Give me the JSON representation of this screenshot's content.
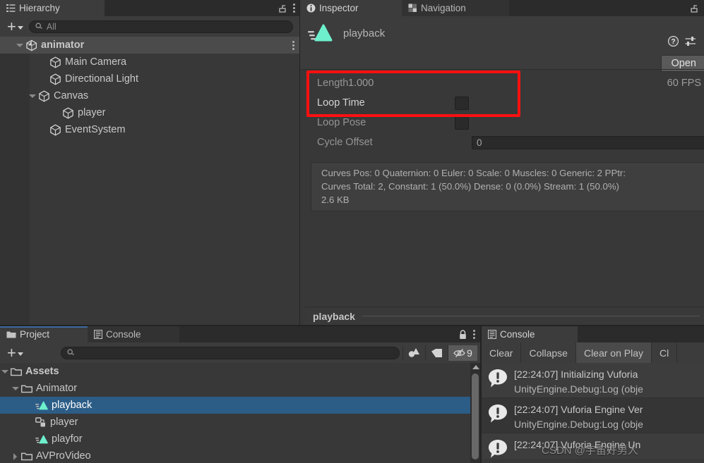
{
  "hierarchy": {
    "tab_label": "Hierarchy",
    "tab_icon": "hierarchy-icon",
    "add_label": "+",
    "search": {
      "placeholder": "All",
      "value": "",
      "icon": "search-icon"
    },
    "items": [
      {
        "label": "animator",
        "icon": "unity-scene-icon",
        "indent": 34,
        "expanded": true,
        "selected": true,
        "bold": true,
        "kebab": true
      },
      {
        "label": "Main Camera",
        "icon": "gameobject-icon",
        "indent": 68,
        "expanded": null,
        "selected": false,
        "bold": false,
        "kebab": false
      },
      {
        "label": "Directional Light",
        "icon": "gameobject-icon",
        "indent": 68,
        "expanded": null,
        "selected": false,
        "bold": false,
        "kebab": false
      },
      {
        "label": "Canvas",
        "icon": "gameobject-icon",
        "indent": 52,
        "expanded": true,
        "selected": false,
        "bold": false,
        "kebab": false
      },
      {
        "label": "player",
        "icon": "gameobject-icon",
        "indent": 86,
        "expanded": null,
        "selected": false,
        "bold": false,
        "kebab": false
      },
      {
        "label": "EventSystem",
        "icon": "gameobject-icon",
        "indent": 68,
        "expanded": null,
        "selected": false,
        "bold": false,
        "kebab": false
      }
    ]
  },
  "inspector": {
    "tabs": [
      {
        "label": "Inspector",
        "icon": "info-icon",
        "active": true
      },
      {
        "label": "Navigation",
        "icon": "navigation-icon",
        "active": false
      }
    ],
    "asset_name": "playback",
    "asset_icon": "animation-clip-icon",
    "help_icon": "help-icon",
    "preset_icon": "preset-icon",
    "open_button": "Open",
    "fps_label": "60 FPS",
    "length_label": "Length",
    "length_value": "1.000",
    "loop_time_label": "Loop Time",
    "loop_time_checked": false,
    "loop_pose_label": "Loop Pose",
    "loop_pose_checked": false,
    "cycle_offset_label": "Cycle Offset",
    "cycle_offset_value": "0",
    "curves_line1": "Curves Pos: 0 Quaternion: 0 Euler: 0 Scale: 0 Muscles: 0 Generic: 2 PPtr:",
    "curves_line2": "Curves Total: 2, Constant: 1 (50.0%) Dense: 0 (0.0%) Stream: 1 (50.0%)",
    "curves_line3": "2.6 KB",
    "preview_label": "playback",
    "highlight_color": "#ff1010"
  },
  "project": {
    "tabs": [
      {
        "label": "Project",
        "icon": "folder-icon",
        "active": true
      },
      {
        "label": "Console",
        "icon": "console-icon",
        "active": false
      }
    ],
    "accent_color": "#3d6a9e",
    "lock_icon": "lock-icon",
    "menu_icon": "kebab-menu-icon",
    "add_label": "+",
    "search": {
      "placeholder": "",
      "value": "",
      "icon": "search-icon"
    },
    "filter_type_icon": "filter-by-type-icon",
    "filter_label_icon": "filter-by-label-icon",
    "hidden_packages_icon": "hidden-packages-icon",
    "hidden_packages_count": "9",
    "items": [
      {
        "label": "Assets",
        "icon": "folder-icon",
        "indent": 10,
        "expanded": true,
        "selected": false,
        "bold": true
      },
      {
        "label": "Animator",
        "icon": "folder-icon",
        "indent": 28,
        "expanded": true,
        "selected": false,
        "bold": false
      },
      {
        "label": "playback",
        "icon": "animation-clip-icon",
        "indent": 48,
        "expanded": null,
        "selected": true,
        "bold": false
      },
      {
        "label": "player",
        "icon": "animator-controller-icon",
        "indent": 48,
        "expanded": null,
        "selected": false,
        "bold": false
      },
      {
        "label": "playfor",
        "icon": "animation-clip-icon",
        "indent": 48,
        "expanded": null,
        "selected": false,
        "bold": false
      },
      {
        "label": "AVProVideo",
        "icon": "folder-icon",
        "indent": 28,
        "expanded": false,
        "selected": false,
        "bold": false
      }
    ]
  },
  "console": {
    "tab_label": "Console",
    "tab_icon": "console-icon",
    "buttons": [
      {
        "label": "Clear",
        "pressed": false
      },
      {
        "label": "Collapse",
        "pressed": false
      },
      {
        "label": "Clear on Play",
        "pressed": true
      },
      {
        "label": "Cl",
        "pressed": false
      }
    ],
    "entries": [
      {
        "icon": "warning-icon",
        "line1": "[22:24:07] Initializing Vuforia",
        "line2": "UnityEngine.Debug:Log (obje"
      },
      {
        "icon": "warning-icon",
        "line1": "[22:24:07] Vuforia Engine Ver",
        "line2": "UnityEngine.Debug:Log (obje"
      },
      {
        "icon": "warning-icon",
        "line1": "[22:24:07] Vuforia Engine Un",
        "line2": ""
      }
    ]
  },
  "watermark": {
    "text": "CSDN @宇宙好男人"
  }
}
